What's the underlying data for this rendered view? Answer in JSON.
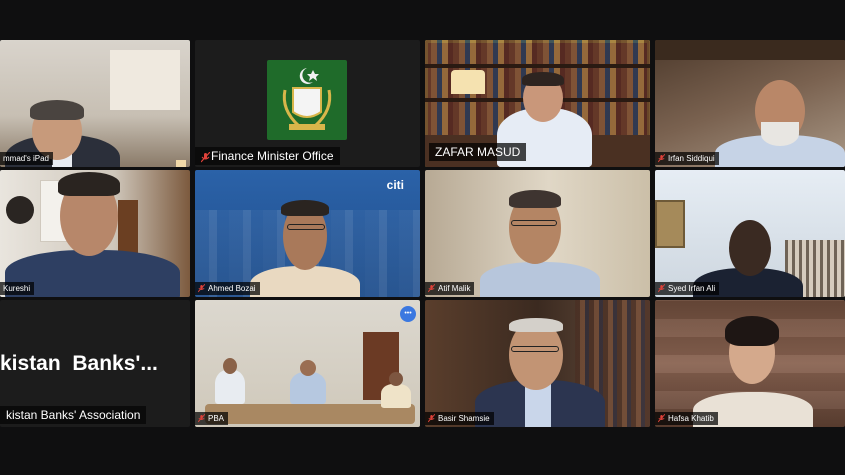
{
  "participants": [
    {
      "name": "mmad's iPad",
      "muted": false
    },
    {
      "name": "Finance Minister Office",
      "muted": true
    },
    {
      "name": "ZAFAR MASUD",
      "muted": false
    },
    {
      "name": "Irfan Siddiqui",
      "muted": true
    },
    {
      "name": "Kureshi",
      "muted": false
    },
    {
      "name": "Ahmed Bozai",
      "muted": true
    },
    {
      "name": "Atif Malik",
      "muted": true
    },
    {
      "name": "Syed Irfan Ali",
      "muted": true
    },
    {
      "name": "kistan Banks' Association",
      "muted": false
    },
    {
      "name": "PBA",
      "muted": true
    },
    {
      "name": "Basir Shamsie",
      "muted": true
    },
    {
      "name": "Hafsa Khatib",
      "muted": true
    }
  ],
  "pba_tile_title": "kistan  Banks'...",
  "citi_logo": "citi",
  "more_button": "•••",
  "colors": {
    "active_speaker": "#b6e64a",
    "muted_icon": "#e0423a",
    "emblem_green": "#1f6b2a"
  }
}
